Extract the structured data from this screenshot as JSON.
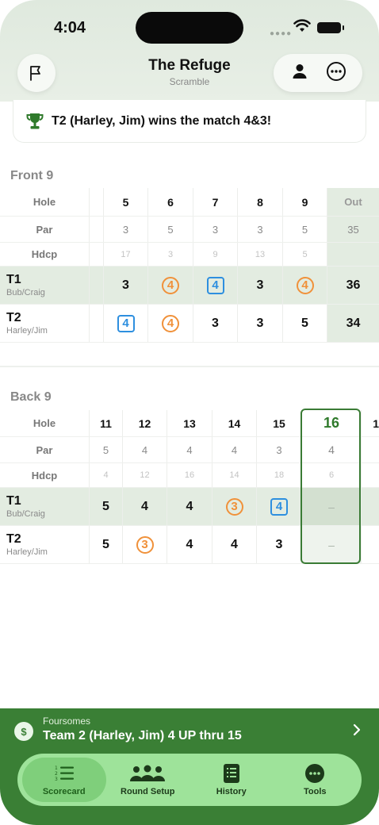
{
  "status": {
    "time": "4:04"
  },
  "header": {
    "title": "The Refuge",
    "subtitle": "Scramble"
  },
  "banner": {
    "text": "T2 (Harley, Jim) wins the match 4&3!"
  },
  "front9": {
    "title": "Front 9",
    "labels": {
      "hole": "Hole",
      "par": "Par",
      "hdcp": "Hdcp"
    },
    "holes": [
      "5",
      "6",
      "7",
      "8",
      "9"
    ],
    "out_label": "Out",
    "par": [
      "3",
      "5",
      "3",
      "3",
      "5"
    ],
    "par_out": "35",
    "hdcp": [
      "17",
      "3",
      "9",
      "13",
      "5"
    ],
    "teams": [
      {
        "name": "T1",
        "players": "Bub/Craig",
        "scores": [
          "3",
          "4",
          "4",
          "3",
          "4"
        ],
        "out": "36"
      },
      {
        "name": "T2",
        "players": "Harley/Jim",
        "scores": [
          "4",
          "4",
          "3",
          "3",
          "5"
        ],
        "out": "34"
      }
    ]
  },
  "back9": {
    "title": "Back 9",
    "labels": {
      "hole": "Hole",
      "par": "Par",
      "hdcp": "Hdcp"
    },
    "holes": [
      "11",
      "12",
      "13",
      "14",
      "15",
      "16",
      "1"
    ],
    "par": [
      "5",
      "4",
      "4",
      "4",
      "3",
      "4"
    ],
    "hdcp": [
      "4",
      "12",
      "16",
      "14",
      "18",
      "6"
    ],
    "teams": [
      {
        "name": "T1",
        "players": "Bub/Craig",
        "scores": [
          "5",
          "4",
          "4",
          "3",
          "4",
          "–"
        ]
      },
      {
        "name": "T2",
        "players": "Harley/Jim",
        "scores": [
          "5",
          "3",
          "4",
          "4",
          "3",
          "–"
        ]
      }
    ]
  },
  "match": {
    "format": "Foursomes",
    "status": "Team 2 (Harley, Jim)  4 UP thru 15"
  },
  "tabs": [
    {
      "label": "Scorecard",
      "icon": "list-icon"
    },
    {
      "label": "Round Setup",
      "icon": "people-icon"
    },
    {
      "label": "History",
      "icon": "document-icon"
    },
    {
      "label": "Tools",
      "icon": "ellipsis-circle-icon"
    }
  ],
  "colors": {
    "accent_green": "#3a7f35",
    "birdie": "#f0913a",
    "bogey": "#2e8fdf",
    "highlight_row": "#e3ece1"
  }
}
